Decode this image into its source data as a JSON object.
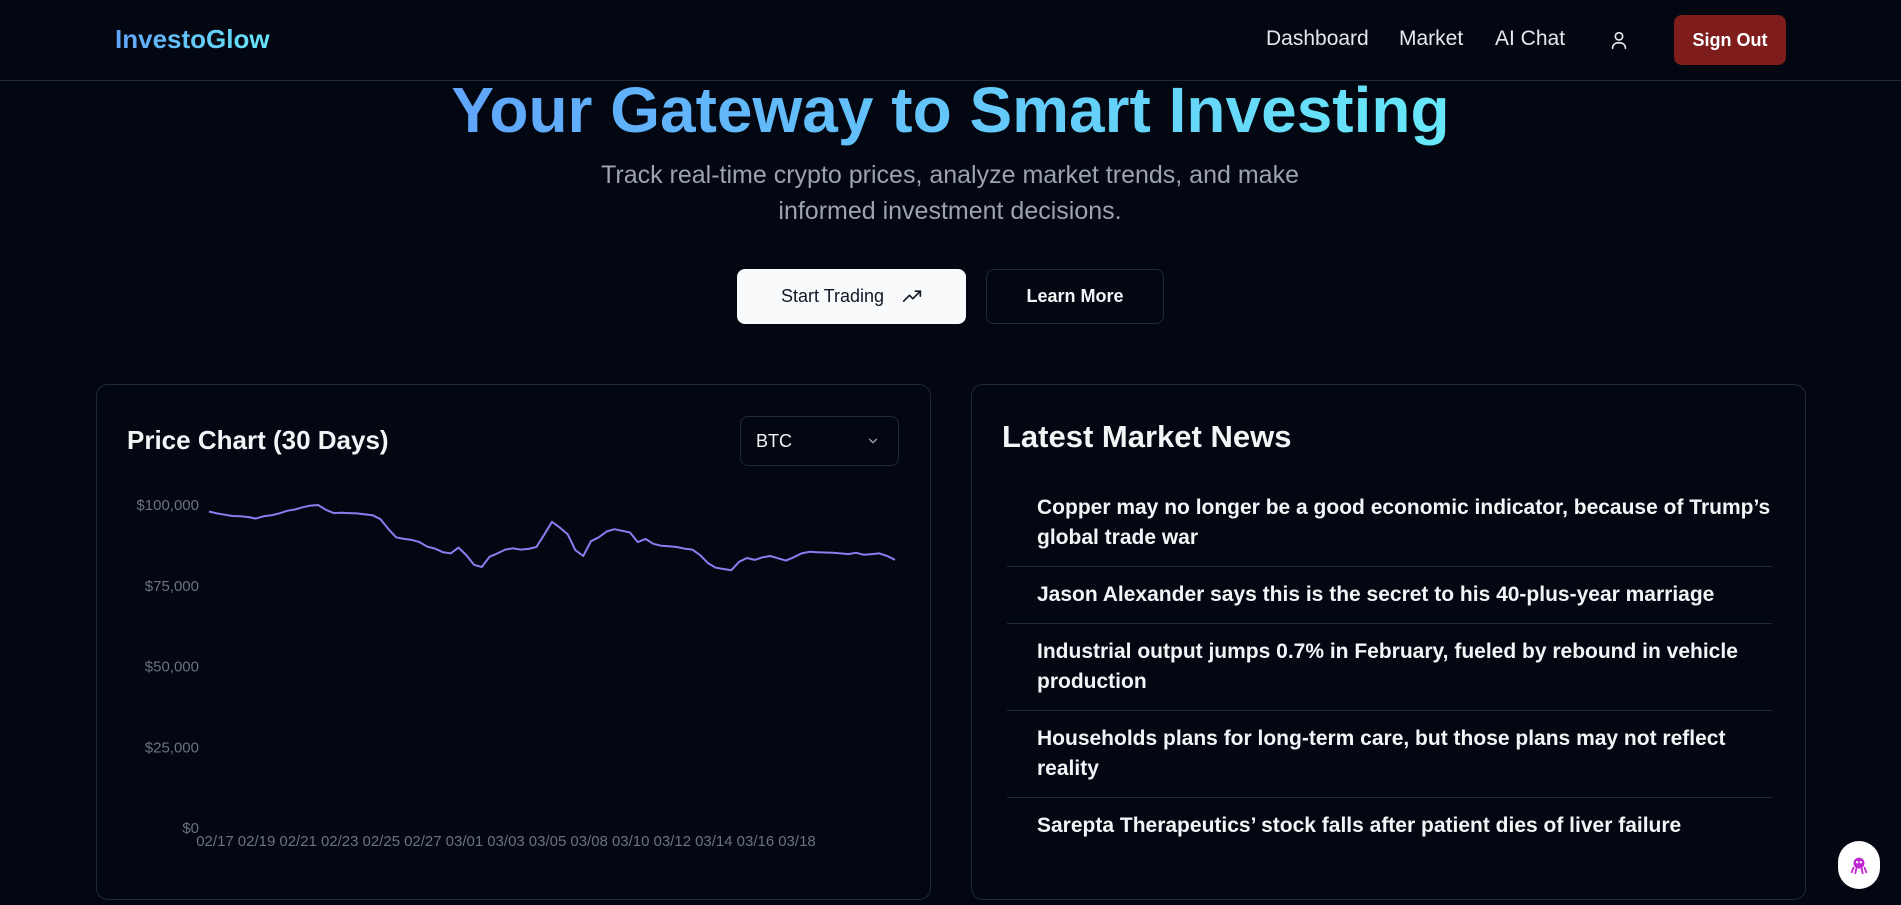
{
  "nav": {
    "brand": "InvestoGlow",
    "links": [
      "Dashboard",
      "Market",
      "AI Chat"
    ],
    "signout_label": "Sign Out"
  },
  "hero": {
    "title": "Your Gateway to Smart Investing",
    "subtitle": "Track real-time crypto prices, analyze market trends, and make informed investment decisions.",
    "primary_button": "Start Trading",
    "secondary_button": "Learn More"
  },
  "chart_card": {
    "title": "Price Chart (30 Days)",
    "selected_coin": "BTC"
  },
  "chart_data": {
    "type": "line",
    "title": "Price Chart (30 Days)",
    "xlabel": "",
    "ylabel": "",
    "ylim": [
      0,
      100000
    ],
    "yticks": [
      "$0",
      "$25,000",
      "$50,000",
      "$75,000",
      "$100,000"
    ],
    "ytick_values": [
      0,
      25000,
      50000,
      75000,
      100000
    ],
    "xticks": [
      "02/17",
      "02/19",
      "02/21",
      "02/23",
      "02/25",
      "02/27",
      "03/01",
      "03/03",
      "03/05",
      "03/08",
      "03/10",
      "03/12",
      "03/14",
      "03/16",
      "03/18"
    ],
    "grid": false,
    "color": "#8b7cf0",
    "series": [
      {
        "values": [
          98000,
          97400,
          97000,
          96600,
          96500,
          96300,
          95800,
          96500,
          96800,
          97400,
          98200,
          98600,
          99300,
          99800,
          100000,
          98500,
          97500,
          97600,
          97500,
          97400,
          97100,
          96800,
          95600,
          92600,
          90000,
          89500,
          89200,
          88500,
          87100,
          86500,
          85400,
          85000,
          86800,
          84500,
          81500,
          80800,
          84000,
          85000,
          86200,
          86600,
          86200,
          86400,
          87000,
          90800,
          94800,
          93000,
          91000,
          86000,
          84200,
          88800,
          90000,
          91800,
          92500,
          92000,
          91500,
          88500,
          89500,
          88000,
          87400,
          87200,
          87000,
          86500,
          86200,
          84500,
          82000,
          80600,
          80200,
          79800,
          82400,
          83600,
          83000,
          83800,
          84200,
          83500,
          82800,
          83800,
          85000,
          85500,
          85400,
          85300,
          85200,
          85000,
          84800,
          85200,
          84600,
          84800,
          85000,
          84200,
          83000
        ]
      }
    ]
  },
  "news": {
    "title": "Latest Market News",
    "items": [
      "Copper may no longer be a good economic indicator, because of Trump’s global trade war",
      "Jason Alexander says this is the secret to his 40-plus-year marriage",
      "Industrial output jumps 0.7% in February, fueled by rebound in vehicle production",
      "Households plans for long-term care, but those plans may not reflect reality",
      "Sarepta Therapeutics’ stock falls after patient dies of liver failure"
    ]
  }
}
